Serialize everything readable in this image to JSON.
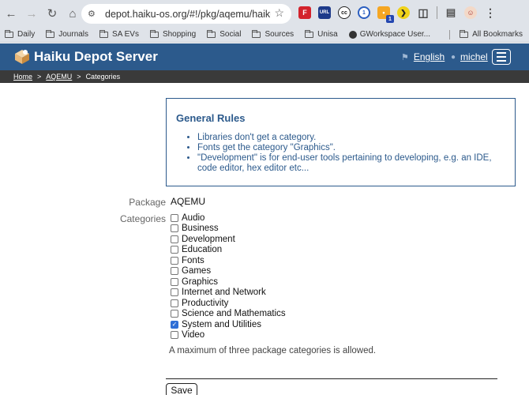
{
  "browser": {
    "url": "depot.haiku-os.org/#!/pkg/aqemu/haikupor...",
    "bookmarks": [
      "Daily",
      "Journals",
      "SA EVs",
      "Shopping",
      "Social",
      "Sources",
      "Unisa",
      "GWorkspace User...",
      "All Bookmarks"
    ],
    "ext_badge": "1"
  },
  "header": {
    "title": "Haiku Depot Server",
    "language": "English",
    "user": "michel"
  },
  "breadcrumbs": {
    "home": "Home",
    "package": "AQEMU",
    "current": "Categories",
    "separator": ">"
  },
  "rules": {
    "title": "General Rules",
    "items": [
      "Libraries don't get a category.",
      "Fonts get the category \"Graphics\".",
      "\"Development\" is for end-user tools pertaining to developing, e.g. an IDE, code editor, hex editor etc..."
    ]
  },
  "form": {
    "package_label": "Package",
    "package_value": "AQEMU",
    "categories_label": "Categories",
    "categories": [
      {
        "label": "Audio",
        "checked": false
      },
      {
        "label": "Business",
        "checked": false
      },
      {
        "label": "Development",
        "checked": false
      },
      {
        "label": "Education",
        "checked": false
      },
      {
        "label": "Fonts",
        "checked": false
      },
      {
        "label": "Games",
        "checked": false
      },
      {
        "label": "Graphics",
        "checked": false
      },
      {
        "label": "Internet and Network",
        "checked": false
      },
      {
        "label": "Productivity",
        "checked": false
      },
      {
        "label": "Science and Mathematics",
        "checked": false
      },
      {
        "label": "System and Utilities",
        "checked": true
      },
      {
        "label": "Video",
        "checked": false
      }
    ],
    "note": "A maximum of three package categories is allowed.",
    "save_label": "Save"
  }
}
